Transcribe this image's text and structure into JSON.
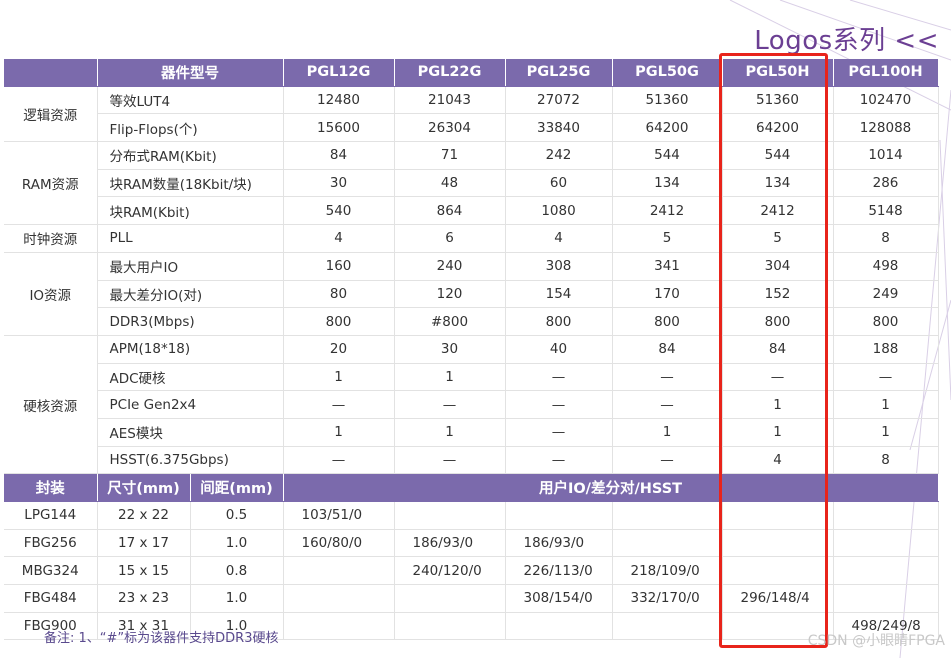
{
  "series_title": "Logos系列 <<",
  "headers": [
    "器件型号",
    "PGL12G",
    "PGL22G",
    "PGL25G",
    "PGL50G",
    "PGL50H",
    "PGL100H"
  ],
  "groups": [
    {
      "category": "逻辑资源",
      "rows": [
        {
          "item": "等效LUT4",
          "values": [
            "12480",
            "21043",
            "27072",
            "51360",
            "51360",
            "102470"
          ]
        },
        {
          "item": "Flip-Flops(个)",
          "values": [
            "15600",
            "26304",
            "33840",
            "64200",
            "64200",
            "128088"
          ]
        }
      ]
    },
    {
      "category": "RAM资源",
      "rows": [
        {
          "item": "分布式RAM(Kbit)",
          "values": [
            "84",
            "71",
            "242",
            "544",
            "544",
            "1014"
          ]
        },
        {
          "item": "块RAM数量(18Kbit/块)",
          "values": [
            "30",
            "48",
            "60",
            "134",
            "134",
            "286"
          ]
        },
        {
          "item": "块RAM(Kbit)",
          "values": [
            "540",
            "864",
            "1080",
            "2412",
            "2412",
            "5148"
          ]
        }
      ]
    },
    {
      "category": "时钟资源",
      "rows": [
        {
          "item": "PLL",
          "values": [
            "4",
            "6",
            "4",
            "5",
            "5",
            "8"
          ]
        }
      ]
    },
    {
      "category": "IO资源",
      "rows": [
        {
          "item": "最大用户IO",
          "values": [
            "160",
            "240",
            "308",
            "341",
            "304",
            "498"
          ]
        },
        {
          "item": "最大差分IO(对)",
          "values": [
            "80",
            "120",
            "154",
            "170",
            "152",
            "249"
          ]
        },
        {
          "item": "DDR3(Mbps)",
          "values": [
            "800",
            "#800",
            "800",
            "800",
            "800",
            "800"
          ]
        }
      ]
    },
    {
      "category": "硬核资源",
      "rows": [
        {
          "item": "APM(18*18)",
          "values": [
            "20",
            "30",
            "40",
            "84",
            "84",
            "188"
          ]
        },
        {
          "item": "ADC硬核",
          "values": [
            "1",
            "1",
            "—",
            "—",
            "—",
            "—"
          ]
        },
        {
          "item": "PCIe Gen2x4",
          "values": [
            "—",
            "—",
            "—",
            "—",
            "1",
            "1"
          ]
        },
        {
          "item": "AES模块",
          "values": [
            "1",
            "1",
            "—",
            "1",
            "1",
            "1"
          ]
        },
        {
          "item": "HSST(6.375Gbps)",
          "values": [
            "—",
            "—",
            "—",
            "—",
            "4",
            "8"
          ]
        }
      ]
    }
  ],
  "package_headers": {
    "package": "封装",
    "size": "尺寸(mm)",
    "pitch": "间距(mm)",
    "io": "用户IO/差分对/HSST"
  },
  "packages": [
    {
      "name": "LPG144",
      "size": "22 x 22",
      "pitch": "0.5",
      "values": [
        "103/51/0",
        "",
        "",
        "",
        "",
        ""
      ]
    },
    {
      "name": "FBG256",
      "size": "17 x 17",
      "pitch": "1.0",
      "values": [
        "160/80/0",
        "186/93/0",
        "186/93/0",
        "",
        "",
        ""
      ]
    },
    {
      "name": "MBG324",
      "size": "15 x 15",
      "pitch": "0.8",
      "values": [
        "",
        "240/120/0",
        "226/113/0",
        "218/109/0",
        "",
        ""
      ]
    },
    {
      "name": "FBG484",
      "size": "23 x 23",
      "pitch": "1.0",
      "values": [
        "",
        "",
        "308/154/0",
        "332/170/0",
        "296/148/4",
        ""
      ]
    },
    {
      "name": "FBG900",
      "size": "31 x 31",
      "pitch": "1.0",
      "values": [
        "",
        "",
        "",
        "",
        "",
        "498/249/8"
      ]
    }
  ],
  "note": "备注: 1、“#”标为该器件支持DDR3硬核",
  "watermark": "CSDN @小眼睛FPGA",
  "colors": {
    "header_bg": "#7b6aac",
    "title": "#6b3f93",
    "highlight": "#e8241b"
  }
}
